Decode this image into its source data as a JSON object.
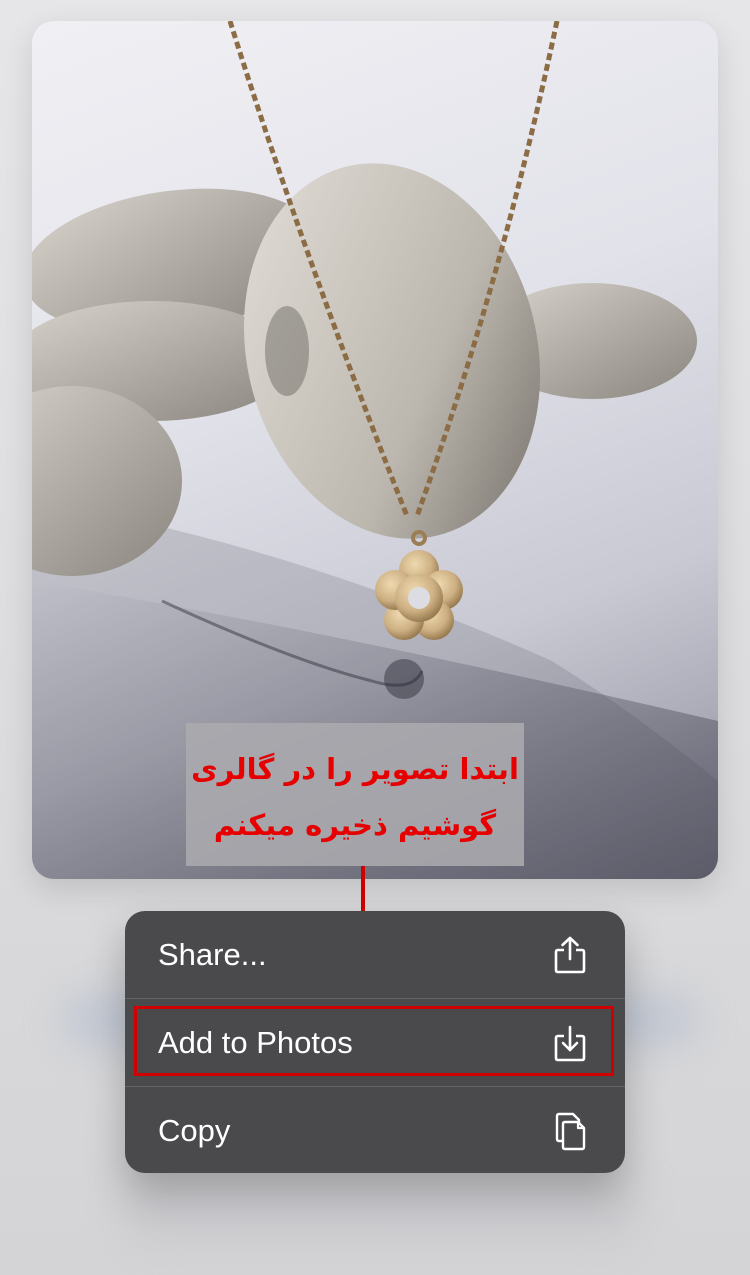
{
  "annotation": {
    "line1": "ابتدا تصویر را در گالری",
    "line2": "گوشیم ذخیره میکنم",
    "color": "#e60000"
  },
  "menu": {
    "items": [
      {
        "label": "Share...",
        "icon": "share-icon"
      },
      {
        "label": "Add to Photos",
        "icon": "save-to-photos-icon",
        "highlighted": true
      },
      {
        "label": "Copy",
        "icon": "copy-icon"
      }
    ]
  },
  "preview": {
    "subject": "necklace-photo"
  }
}
